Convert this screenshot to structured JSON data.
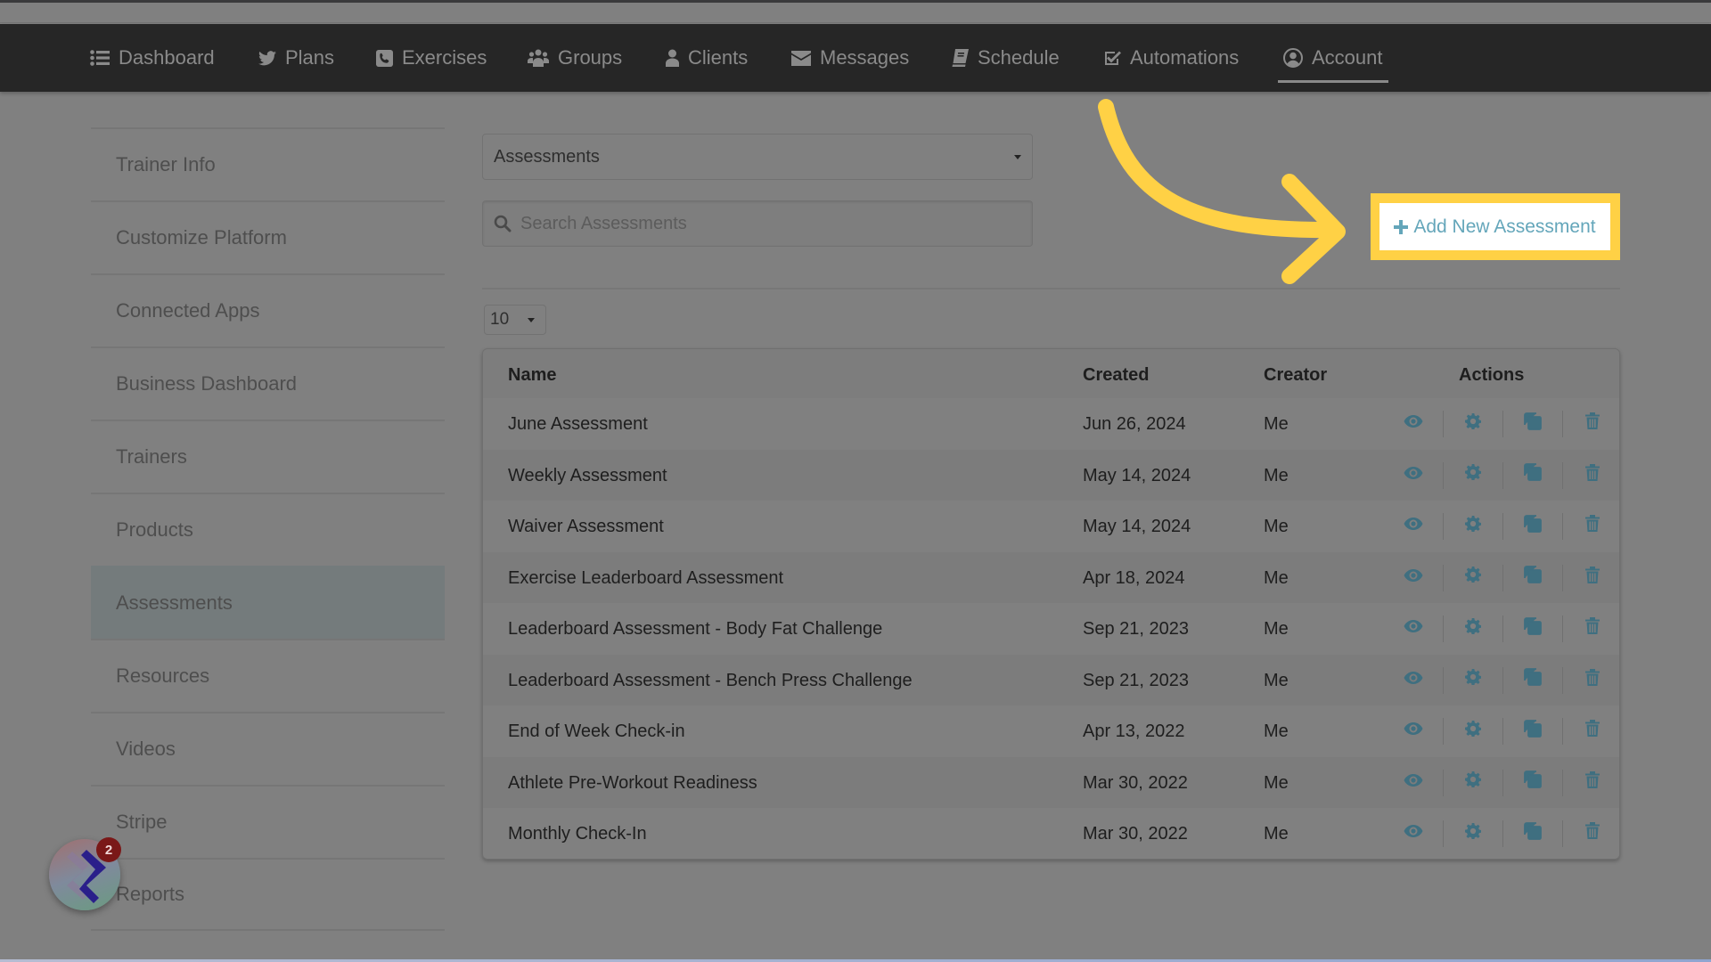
{
  "nav": {
    "items": [
      {
        "label": "Dashboard",
        "icon": "list-icon"
      },
      {
        "label": "Plans",
        "icon": "twitter-bird-icon"
      },
      {
        "label": "Exercises",
        "icon": "phone-square-icon"
      },
      {
        "label": "Groups",
        "icon": "users-icon"
      },
      {
        "label": "Clients",
        "icon": "user-icon"
      },
      {
        "label": "Messages",
        "icon": "envelope-icon"
      },
      {
        "label": "Schedule",
        "icon": "book-icon"
      },
      {
        "label": "Automations",
        "icon": "check-square-icon"
      },
      {
        "label": "Account",
        "icon": "user-circle-icon"
      }
    ],
    "active": "Account"
  },
  "sidebar": {
    "items": [
      {
        "label": "Trainer Info"
      },
      {
        "label": "Customize Platform"
      },
      {
        "label": "Connected Apps"
      },
      {
        "label": "Business Dashboard"
      },
      {
        "label": "Trainers"
      },
      {
        "label": "Products"
      },
      {
        "label": "Assessments"
      },
      {
        "label": "Resources"
      },
      {
        "label": "Videos"
      },
      {
        "label": "Stripe"
      },
      {
        "label": "Reports"
      }
    ],
    "active": "Assessments"
  },
  "controls": {
    "type_select": "Assessments",
    "search_placeholder": "Search Assessments",
    "page_size": "10",
    "add_button": "Add New Assessment"
  },
  "table": {
    "headers": {
      "name": "Name",
      "created": "Created",
      "creator": "Creator",
      "actions": "Actions"
    },
    "rows": [
      {
        "name": "June Assessment",
        "created": "Jun 26, 2024",
        "creator": "Me"
      },
      {
        "name": "Weekly Assessment",
        "created": "May 14, 2024",
        "creator": "Me"
      },
      {
        "name": "Waiver Assessment",
        "created": "May 14, 2024",
        "creator": "Me"
      },
      {
        "name": "Exercise Leaderboard Assessment",
        "created": "Apr 18, 2024",
        "creator": "Me"
      },
      {
        "name": "Leaderboard Assessment - Body Fat Challenge",
        "created": "Sep 21, 2023",
        "creator": "Me"
      },
      {
        "name": "Leaderboard Assessment - Bench Press Challenge",
        "created": "Sep 21, 2023",
        "creator": "Me"
      },
      {
        "name": "End of Week Check-in",
        "created": "Apr 13, 2022",
        "creator": "Me"
      },
      {
        "name": "Athlete Pre-Workout Readiness",
        "created": "Mar 30, 2022",
        "creator": "Me"
      },
      {
        "name": "Monthly Check-In",
        "created": "Mar 30, 2022",
        "creator": "Me"
      }
    ],
    "row_actions": [
      "view",
      "settings",
      "duplicate",
      "delete"
    ]
  },
  "widget": {
    "badge_count": "2"
  },
  "colors": {
    "highlight": "#ffd145",
    "accent": "#64a6ba",
    "action_icon": "#3f6f80"
  }
}
